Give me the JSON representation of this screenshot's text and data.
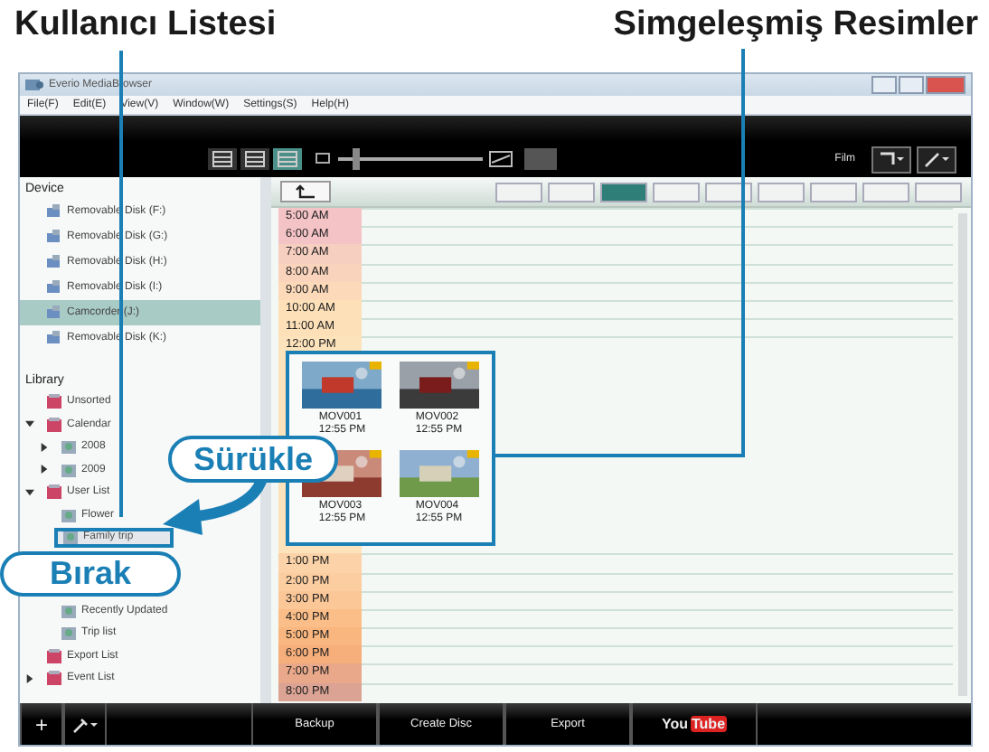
{
  "annotations": {
    "user_list": "Kullanıcı Listesi",
    "thumbnails": "Simgeleşmiş Resimler",
    "drag": "Sürükle",
    "drop": "Bırak"
  },
  "window": {
    "title": "Everio MediaBrowser"
  },
  "menu": [
    "File(F)",
    "Edit(E)",
    "View(V)",
    "Window(W)",
    "Settings(S)",
    "Help(H)"
  ],
  "toolbar": {
    "views": [
      {
        "selected": false
      },
      {
        "selected": false
      },
      {
        "selected": true
      }
    ],
    "zoom": {
      "level": 0.1
    },
    "filter_label": "Film"
  },
  "sidebar": {
    "device_header": "Device",
    "devices": [
      {
        "label": "Removable Disk (F:)",
        "selected": false
      },
      {
        "label": "Removable Disk (G:)",
        "selected": false
      },
      {
        "label": "Removable Disk (H:)",
        "selected": false
      },
      {
        "label": "Removable Disk (I:)",
        "selected": false
      },
      {
        "label": "Camcorder (J:)",
        "selected": true
      },
      {
        "label": "Removable Disk (K:)",
        "selected": false
      }
    ],
    "library_header": "Library",
    "library": [
      {
        "label": "Unsorted",
        "selected": false
      },
      {
        "label": "Calendar",
        "expanded": true,
        "selected": false,
        "children": [
          {
            "label": "2008",
            "expanded": false,
            "selected": false
          },
          {
            "label": "2009",
            "expanded": false,
            "selected": false
          }
        ]
      },
      {
        "label": "User List",
        "expanded": true,
        "selected": false,
        "children": [
          {
            "label": "Flower",
            "selected": false
          },
          {
            "label": "Family trip",
            "selected": true
          }
        ]
      },
      {
        "children": [
          {
            "label": "Recently Updated",
            "selected": false
          },
          {
            "label": "Trip list",
            "selected": false
          }
        ]
      },
      {
        "label": "Export List",
        "selected": false
      },
      {
        "label": "Event List",
        "expanded": false,
        "selected": false
      }
    ]
  },
  "nav": {
    "buttons": [
      {
        "selected": false
      },
      {
        "selected": false
      },
      {
        "selected": true
      },
      {
        "selected": false
      },
      {
        "selected": false
      },
      {
        "selected": false
      },
      {
        "selected": false
      },
      {
        "selected": false
      },
      {
        "selected": false
      }
    ]
  },
  "timeline": [
    {
      "time": "5:00 AM",
      "color": "#f4c3c6"
    },
    {
      "time": "6:00 AM",
      "color": "#f4c3c6"
    },
    {
      "time": "7:00 AM",
      "color": "#f7cfc0"
    },
    {
      "time": "8:00 AM",
      "color": "#f9d3bb"
    },
    {
      "time": "9:00 AM",
      "color": "#fbd9b9"
    },
    {
      "time": "10:00 AM",
      "color": "#fde0b8"
    },
    {
      "time": "11:00 AM",
      "color": "#fde0b8"
    },
    {
      "time": "12:00 PM",
      "color": "#fde3bb",
      "tall": true
    },
    {
      "time": "1:00 PM",
      "color": "#fcd3a8"
    },
    {
      "time": "2:00 PM",
      "color": "#fccda0"
    },
    {
      "time": "3:00 PM",
      "color": "#fcc797"
    },
    {
      "time": "4:00 PM",
      "color": "#fbbe88"
    },
    {
      "time": "5:00 PM",
      "color": "#f9b67e"
    },
    {
      "time": "6:00 PM",
      "color": "#f6ae7a"
    },
    {
      "time": "7:00 PM",
      "color": "#e9a88a"
    },
    {
      "time": "8:00 PM",
      "color": "#dba394"
    }
  ],
  "thumbnails": [
    {
      "name": "MOV001",
      "time": "12:55 PM"
    },
    {
      "name": "MOV002",
      "time": "12:55 PM"
    },
    {
      "name": "MOV003",
      "time": "12:55 PM"
    },
    {
      "name": "MOV004",
      "time": "12:55 PM"
    }
  ],
  "bottom_bar": {
    "add": "+",
    "buttons": [
      "Backup",
      "Create Disc",
      "Export"
    ],
    "youtube": {
      "you": "You",
      "tube": "Tube"
    }
  }
}
